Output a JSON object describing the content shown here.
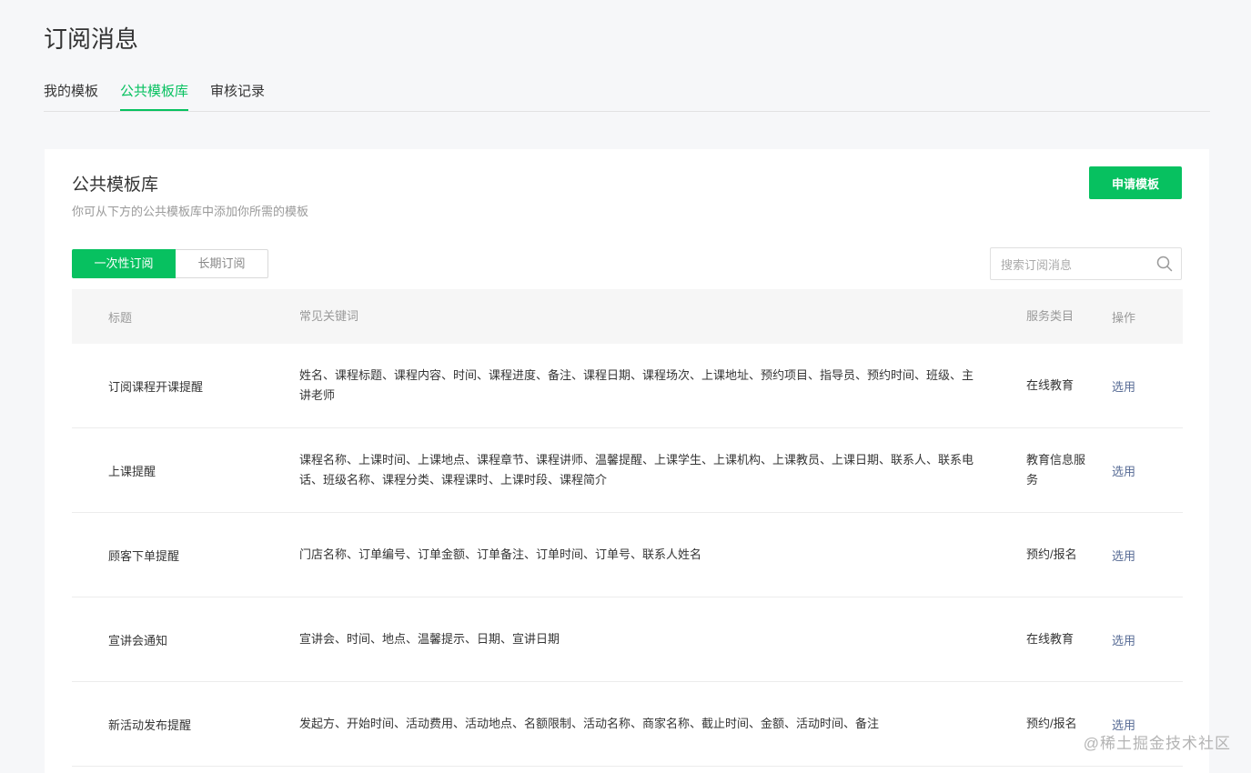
{
  "page": {
    "title": "订阅消息"
  },
  "tabs": [
    {
      "label": "我的模板",
      "active": false
    },
    {
      "label": "公共模板库",
      "active": true
    },
    {
      "label": "审核记录",
      "active": false
    }
  ],
  "card": {
    "title": "公共模板库",
    "description": "你可从下方的公共模板库中添加你所需的模板",
    "apply_label": "申请模板"
  },
  "segment": {
    "one_time": "一次性订阅",
    "long_term": "长期订阅"
  },
  "search": {
    "placeholder": "搜索订阅消息"
  },
  "table": {
    "headers": {
      "title": "标题",
      "keywords": "常见关键词",
      "category": "服务类目",
      "action": "操作"
    },
    "rows": [
      {
        "title": "订阅课程开课提醒",
        "keywords": "姓名、课程标题、课程内容、时间、课程进度、备注、课程日期、课程场次、上课地址、预约项目、指导员、预约时间、班级、主讲老师",
        "category": "在线教育",
        "action": "选用"
      },
      {
        "title": "上课提醒",
        "keywords": "课程名称、上课时间、上课地点、课程章节、课程讲师、温馨提醒、上课学生、上课机构、上课教员、上课日期、联系人、联系电话、班级名称、课程分类、课程课时、上课时段、课程简介",
        "category": "教育信息服务",
        "action": "选用"
      },
      {
        "title": "顾客下单提醒",
        "keywords": "门店名称、订单编号、订单金额、订单备注、订单时间、订单号、联系人姓名",
        "category": "预约/报名",
        "action": "选用"
      },
      {
        "title": "宣讲会通知",
        "keywords": "宣讲会、时间、地点、温馨提示、日期、宣讲日期",
        "category": "在线教育",
        "action": "选用"
      },
      {
        "title": "新活动发布提醒",
        "keywords": "发起方、开始时间、活动费用、活动地点、名额限制、活动名称、商家名称、截止时间、金额、活动时间、备注",
        "category": "预约/报名",
        "action": "选用"
      }
    ]
  },
  "watermark": "@稀土掘金技术社区",
  "colors": {
    "accent": "#07c160",
    "link": "#576b95"
  }
}
